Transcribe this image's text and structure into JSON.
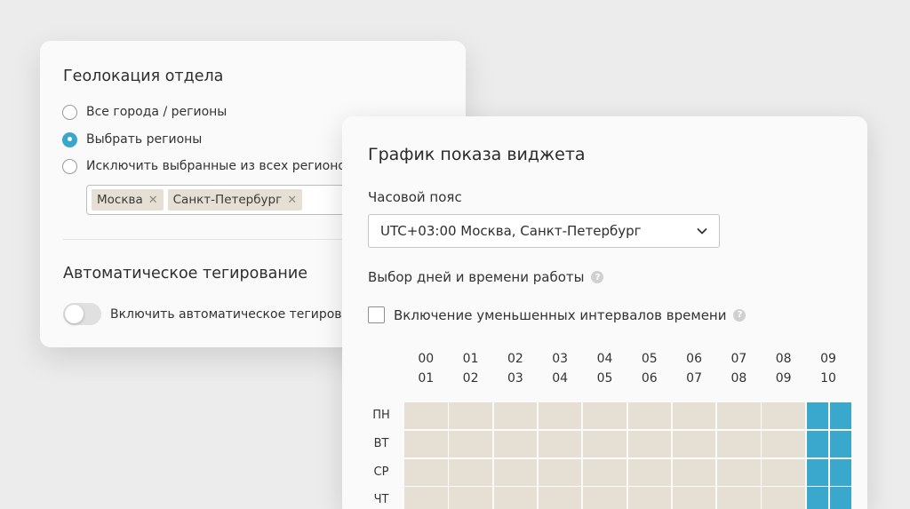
{
  "geolocation": {
    "title": "Геолокация отдела",
    "options": [
      {
        "label": "Все города / регионы",
        "checked": false
      },
      {
        "label": "Выбрать регионы",
        "checked": true
      },
      {
        "label": "Исключить выбранные из всех регионов",
        "checked": false
      }
    ],
    "tags": [
      "Москва",
      "Санкт-Петербург"
    ]
  },
  "auto_tagging": {
    "title": "Автоматическое тегирование",
    "toggle_label": "Включить автоматическое тегирование",
    "enabled": false
  },
  "schedule": {
    "title": "График показа виджета",
    "timezone_label": "Часовой пояс",
    "timezone_value": "UTC+03:00 Москва, Санкт-Петербург",
    "days_label": "Выбор дней и времени работы",
    "reduced_intervals_label": "Включение уменьшенных интервалов времени",
    "reduced_intervals_checked": false,
    "hours": [
      {
        "from": "00",
        "to": "01"
      },
      {
        "from": "01",
        "to": "02"
      },
      {
        "from": "02",
        "to": "03"
      },
      {
        "from": "03",
        "to": "04"
      },
      {
        "from": "04",
        "to": "05"
      },
      {
        "from": "05",
        "to": "06"
      },
      {
        "from": "06",
        "to": "07"
      },
      {
        "from": "07",
        "to": "08"
      },
      {
        "from": "08",
        "to": "09"
      },
      {
        "from": "09",
        "to": "10"
      }
    ],
    "days": [
      "ПН",
      "ВТ",
      "СР",
      "ЧТ"
    ],
    "active_from_hour": "09"
  },
  "colors": {
    "accent": "#3aa8cc",
    "cell_inactive": "#e6e0d4",
    "tag_bg": "#e6e0d4",
    "background": "#ececec"
  },
  "icons": {
    "tag_remove": "close-icon",
    "select": "chevron-down-icon",
    "help": "question-icon"
  }
}
